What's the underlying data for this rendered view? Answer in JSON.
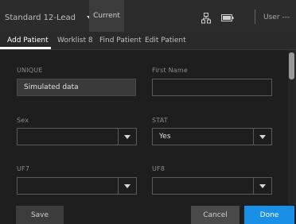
{
  "topbar": {
    "mode_label": "Standard 12-Lead",
    "current_tab_label": "Current",
    "user_label": "User ---",
    "icons": [
      "network-icon",
      "battery-icon",
      "chevron-down-icon"
    ]
  },
  "tabs": [
    {
      "label": "Add Patient",
      "active": true
    },
    {
      "label": "Worklist 8",
      "active": false
    },
    {
      "label": "Find Patient",
      "active": false
    },
    {
      "label": "Edit Patient",
      "active": false
    }
  ],
  "form": {
    "unique": {
      "label": "UNIQUE",
      "value": "Simulated data"
    },
    "first_name": {
      "label": "First Name",
      "value": ""
    },
    "sex": {
      "label": "Sex",
      "value": ""
    },
    "stat": {
      "label": "STAT",
      "value": "Yes"
    },
    "uf7": {
      "label": "UF7",
      "value": ""
    },
    "uf8": {
      "label": "UF8",
      "value": ""
    }
  },
  "buttons": {
    "save": "Save",
    "cancel": "Cancel",
    "done": "Done"
  },
  "colors": {
    "accent": "#1a8fe6",
    "background": "#1e1e1e",
    "topbar": "#2c2c2c"
  }
}
